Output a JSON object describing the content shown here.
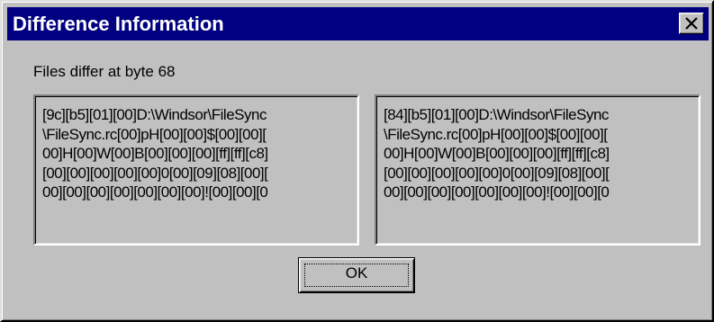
{
  "window": {
    "title": "Difference Information",
    "close_icon": "close-icon"
  },
  "status": {
    "message": "Files differ at byte 68"
  },
  "left_panel": {
    "lines": [
      "[9c][b5][01][00]D:\\Windsor\\FileSync",
      "\\FileSync.rc[00]pH[00][00]$[00][00][",
      "00]H[00]W[00]B[00][00][00][ff][ff][c8]",
      "[00][00][00][00][00]0[00][09][08][00][",
      "00][00][00][00][00][00][00]![00][00][0"
    ]
  },
  "right_panel": {
    "lines": [
      "[84][b5][01][00]D:\\Windsor\\FileSync",
      "\\FileSync.rc[00]pH[00][00]$[00][00][",
      "00]H[00]W[00]B[00][00][00][ff][ff][c8]",
      "[00][00][00][00][00]0[00][09][08][00][",
      "00][00][00][00][00][00][00]![00][00][0"
    ]
  },
  "buttons": {
    "ok_label": "OK"
  },
  "colors": {
    "titlebar": "#000080",
    "face": "#c0c0c0",
    "title_text": "#ffffff"
  }
}
